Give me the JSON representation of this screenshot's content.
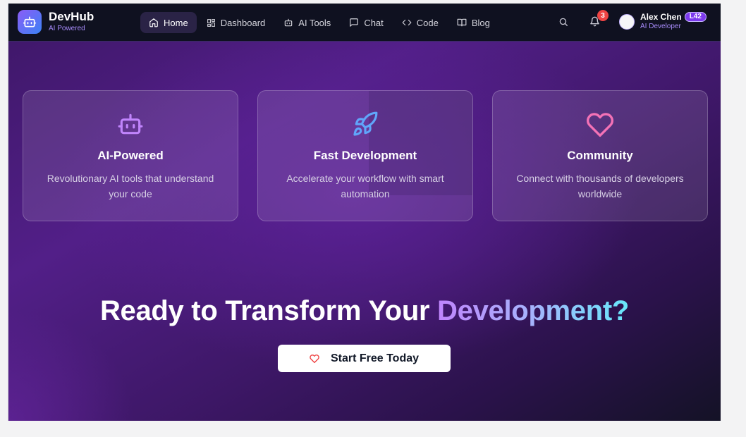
{
  "brand": {
    "name": "DevHub",
    "tagline": "AI Powered"
  },
  "nav": {
    "items": [
      {
        "label": "Home",
        "icon": "home-icon",
        "active": true
      },
      {
        "label": "Dashboard",
        "icon": "grid-icon"
      },
      {
        "label": "AI Tools",
        "icon": "bot-icon"
      },
      {
        "label": "Chat",
        "icon": "chat-icon"
      },
      {
        "label": "Code",
        "icon": "code-icon"
      },
      {
        "label": "Blog",
        "icon": "book-icon"
      }
    ]
  },
  "header": {
    "notifications_count": "3",
    "user": {
      "name": "Alex Chen",
      "level": "L42",
      "role": "AI Developer"
    }
  },
  "features": [
    {
      "title": "AI-Powered",
      "description": "Revolutionary AI tools that understand your code",
      "icon": "bot-icon",
      "icon_color": "#c084fc"
    },
    {
      "title": "Fast Development",
      "description": "Accelerate your workflow with smart automation",
      "icon": "rocket-icon",
      "icon_color": "#60a5fa"
    },
    {
      "title": "Community",
      "description": "Connect with thousands of developers worldwide",
      "icon": "heart-icon",
      "icon_color": "#f472b6"
    }
  ],
  "cta": {
    "title_prefix": "Ready to Transform Your ",
    "title_highlight": "Development?",
    "button_label": "Start Free Today",
    "button_icon": "heart-icon"
  },
  "colors": {
    "accent": "#8b5cf6",
    "nav_bg": "#0f1120",
    "badge": "#ef4444"
  }
}
